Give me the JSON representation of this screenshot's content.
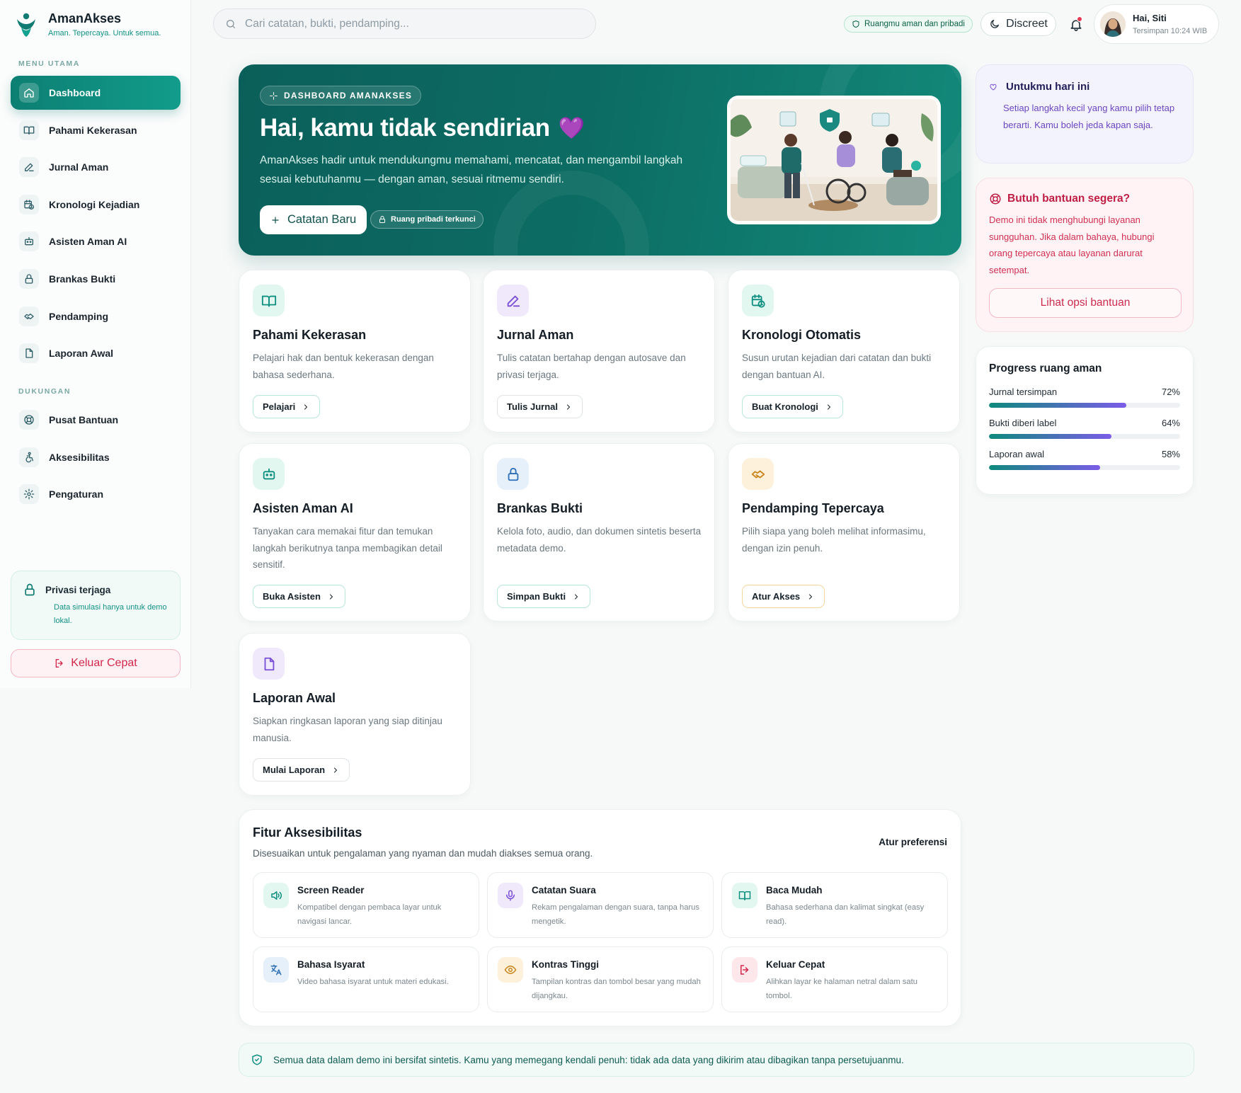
{
  "brand": {
    "name": "AmanAkses",
    "tagline": "Aman. Tepercaya. Untuk semua."
  },
  "sidebar": {
    "main_label": "MENU UTAMA",
    "items": [
      {
        "label": "Dashboard",
        "icon": "home-icon"
      },
      {
        "label": "Pahami Kekerasan",
        "icon": "book-icon"
      },
      {
        "label": "Jurnal Aman",
        "icon": "pencil-icon"
      },
      {
        "label": "Kronologi Kejadian",
        "icon": "calendar-clock-icon"
      },
      {
        "label": "Asisten Aman AI",
        "icon": "robot-icon"
      },
      {
        "label": "Brankas Bukti",
        "icon": "lock-icon"
      },
      {
        "label": "Pendamping",
        "icon": "handshake-icon"
      },
      {
        "label": "Laporan Awal",
        "icon": "document-icon"
      }
    ],
    "support_label": "DUKUNGAN",
    "support_items": [
      {
        "label": "Pusat Bantuan",
        "icon": "lifebuoy-icon"
      },
      {
        "label": "Aksesibilitas",
        "icon": "accessibility-icon"
      },
      {
        "label": "Pengaturan",
        "icon": "gear-icon"
      }
    ],
    "privacy_title": "Privasi terjaga",
    "privacy_desc": "Data simulasi hanya untuk demo lokal.",
    "exit_label": "Keluar Cepat"
  },
  "topbar": {
    "search_placeholder": "Cari catatan, bukti, pendamping...",
    "safe_pill": "Ruangmu aman dan pribadi",
    "discreet_label": "Discreet",
    "user_name": "Hai, Siti",
    "saved_time": "Tersimpan 10:24 WIB"
  },
  "hero": {
    "badge": "DASHBOARD AMANAKSES",
    "title": "Hai, kamu tidak sendirian",
    "emoji": "💜",
    "desc": "AmanAkses hadir untuk mendukungmu memahami, mencatat, dan mengambil langkah sesuai kebutuhanmu — dengan aman, sesuai ritmemu sendiri.",
    "button": "Catatan Baru",
    "lock_pill": "Ruang pribadi terkunci"
  },
  "cards": [
    {
      "title": "Pahami Kekerasan",
      "desc": "Pelajari hak dan bentuk kekerasan dengan bahasa sederhana.",
      "button": "Pelajari",
      "icon": "book-icon",
      "accent": "#0f8f80",
      "tint": "#e3f7f1",
      "border": "#b9e6da"
    },
    {
      "title": "Jurnal Aman",
      "desc": "Tulis catatan bertahap dengan autosave dan privasi terjaga.",
      "button": "Tulis Jurnal",
      "icon": "pencil-icon",
      "accent": "#7a4fd6",
      "tint": "#efe9fb",
      "border": "#dfe3e6"
    },
    {
      "title": "Kronologi Otomatis",
      "desc": "Susun urutan kejadian dari catatan dan bukti dengan bantuan AI.",
      "button": "Buat Kronologi",
      "icon": "calendar-clock-icon",
      "accent": "#0f8f80",
      "tint": "#e3f7f1",
      "border": "#b9e6da"
    },
    {
      "title": "Asisten Aman AI",
      "desc": "Tanyakan cara memakai fitur dan temukan langkah berikutnya tanpa membagikan detail sensitif.",
      "button": "Buka Asisten",
      "icon": "robot-icon",
      "accent": "#0f8f80",
      "tint": "#e3f7f1",
      "border": "#b9e6da"
    },
    {
      "title": "Brankas Bukti",
      "desc": "Kelola foto, audio, dan dokumen sintetis beserta metadata demo.",
      "button": "Simpan Bukti",
      "icon": "lock-icon",
      "accent": "#2c6fb6",
      "tint": "#e6f0fb",
      "border": "#b9e6da"
    },
    {
      "title": "Pendamping Tepercaya",
      "desc": "Pilih siapa yang boleh melihat informasimu, dengan izin penuh.",
      "button": "Atur Akses",
      "icon": "handshake-icon",
      "accent": "#c9861b",
      "tint": "#fdf1dc",
      "border": "#f3d79e"
    },
    {
      "title": "Laporan Awal",
      "desc": "Siapkan ringkasan laporan yang siap ditinjau manusia.",
      "button": "Mulai Laporan",
      "icon": "document-icon",
      "accent": "#7a4fd6",
      "tint": "#efe9fb",
      "border": "#dfe3e6"
    }
  ],
  "today": {
    "title": "Untukmu hari ini",
    "desc": "Setiap langkah kecil yang kamu pilih tetap berarti. Kamu boleh jeda kapan saja."
  },
  "help": {
    "title": "Butuh bantuan segera?",
    "desc": "Demo ini tidak menghubungi layanan sungguhan. Jika dalam bahaya, hubungi orang tepercaya atau layanan darurat setempat.",
    "button": "Lihat opsi bantuan"
  },
  "progress": {
    "title": "Progress ruang aman",
    "items": [
      {
        "label": "Jurnal tersimpan",
        "value": 72,
        "value_text": "72%"
      },
      {
        "label": "Bukti diberi label",
        "value": 64,
        "value_text": "64%"
      },
      {
        "label": "Laporan awal",
        "value": 58,
        "value_text": "58%"
      }
    ]
  },
  "accessibility": {
    "title": "Fitur Aksesibilitas",
    "subtitle": "Disesuaikan untuk pengalaman yang nyaman dan mudah diakses semua orang.",
    "pref_link": "Atur preferensi",
    "features": [
      {
        "title": "Screen Reader",
        "desc": "Kompatibel dengan pembaca layar untuk navigasi lancar.",
        "icon": "speaker-icon",
        "accent": "#0f8f80",
        "tint": "#e3f7f1"
      },
      {
        "title": "Catatan Suara",
        "desc": "Rekam pengalaman dengan suara, tanpa harus mengetik.",
        "icon": "microphone-icon",
        "accent": "#7a4fd6",
        "tint": "#efe9fb"
      },
      {
        "title": "Baca Mudah",
        "desc": "Bahasa sederhana dan kalimat singkat (easy read).",
        "icon": "open-book-icon",
        "accent": "#0f8f80",
        "tint": "#e3f7f1"
      },
      {
        "title": "Bahasa Isyarat",
        "desc": "Video bahasa isyarat untuk materi edukasi.",
        "icon": "translate-icon",
        "accent": "#2c6fb6",
        "tint": "#e6f0fb"
      },
      {
        "title": "Kontras Tinggi",
        "desc": "Tampilan kontras dan tombol besar yang mudah dijangkau.",
        "icon": "eye-icon",
        "accent": "#c9861b",
        "tint": "#fdf1dc"
      },
      {
        "title": "Keluar Cepat",
        "desc": "Alihkan layar ke halaman netral dalam satu tombol.",
        "icon": "exit-icon",
        "accent": "#d4264a",
        "tint": "#fde7eb"
      }
    ]
  },
  "footer": {
    "text": "Semua data dalam demo ini bersifat sintetis. Kamu yang memegang kendali penuh: tidak ada data yang dikirim atau dibagikan tanpa persetujuanmu."
  }
}
